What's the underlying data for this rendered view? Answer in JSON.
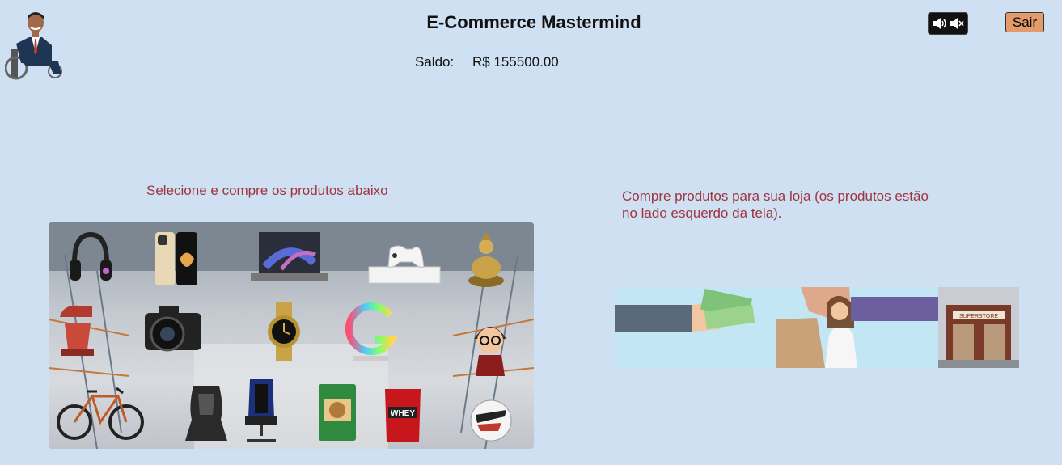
{
  "header": {
    "title": "E-Commerce Mastermind",
    "balance_label": "Saldo:",
    "balance_value": "R$ 155500.00",
    "exit_label": "Sair"
  },
  "sound_toggle": {
    "on_icon": "speaker-on-icon",
    "off_icon": "speaker-off-icon"
  },
  "store": {
    "left_caption": "Selecione e compre os produtos abaixo",
    "right_caption": "Compre produtos para sua loja (os produtos estão no lado esquerdo da tela).",
    "storefront_sign": "SUPERSTORE",
    "products": [
      "headphones",
      "smartphone",
      "laptop",
      "game-console",
      "buddha-statue",
      "stand-mixer",
      "camera",
      "wristwatch",
      "rgb-lamp",
      "collectible-figure",
      "bicycle",
      "car-seat",
      "gaming-chair",
      "dog-food",
      "whey-protein",
      "soccer-ball"
    ]
  },
  "colors": {
    "background": "#cfe0f2",
    "caption": "#a0343f",
    "exit_button": "#e39b6c"
  }
}
